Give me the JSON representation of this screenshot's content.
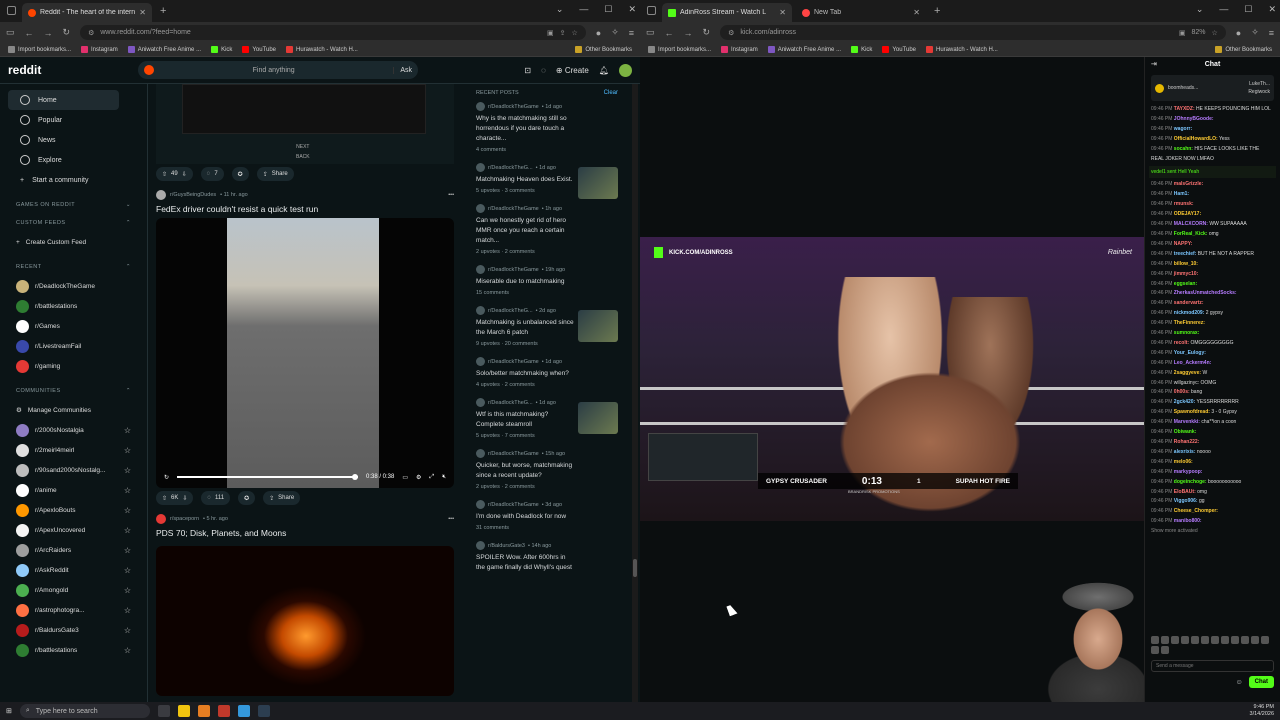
{
  "left_browser": {
    "tabs": [
      {
        "title": "Reddit - The heart of the intern",
        "active": true,
        "color": "#ff4500"
      }
    ],
    "url": "www.reddit.com/?feed=home",
    "bookmarks": [
      "Import bookmarks...",
      "Instagram",
      "Aniwatch Free Anime ...",
      "Kick",
      "YouTube",
      "Hurawatch - Watch H..."
    ],
    "other_bookmarks": "Other Bookmarks"
  },
  "right_browser": {
    "tabs": [
      {
        "title": "AdinRoss Stream - Watch L",
        "active": true,
        "color": "#53fc18"
      },
      {
        "title": "New Tab",
        "active": false,
        "color": "#ff4444"
      }
    ],
    "url": "kick.com/adinross",
    "zoom": "82%",
    "bookmarks": [
      "Import bookmarks...",
      "Instagram",
      "Aniwatch Free Anime ...",
      "Kick",
      "YouTube",
      "Hurawatch - Watch H..."
    ],
    "other_bookmarks": "Other Bookmarks"
  },
  "reddit": {
    "logo": "reddit",
    "search_placeholder": "Find anything",
    "ask_label": "Ask",
    "create_label": "Create",
    "nav": [
      "Home",
      "Popular",
      "News",
      "Explore",
      "Start a community"
    ],
    "sections": {
      "games": "GAMES ON REDDIT",
      "custom": "CUSTOM FEEDS",
      "recent": "RECENT",
      "communities": "COMMUNITIES"
    },
    "create_custom_feed": "Create Custom Feed",
    "recent": [
      {
        "name": "r/DeadlockTheGame",
        "color": "#c9b37a"
      },
      {
        "name": "r/battlestations",
        "color": "#2e7d32"
      },
      {
        "name": "r/Games",
        "color": "#ffffff"
      },
      {
        "name": "r/LivestreamFail",
        "color": "#3949ab"
      },
      {
        "name": "r/gaming",
        "color": "#e53935"
      }
    ],
    "manage_communities": "Manage Communities",
    "communities": [
      {
        "name": "r/2000sNostalgia",
        "color": "#8e7cc3"
      },
      {
        "name": "r/2meirl4meirl",
        "color": "#e0e0e0"
      },
      {
        "name": "r/90sand2000sNostalg...",
        "color": "#bdbdbd"
      },
      {
        "name": "r/anime",
        "color": "#ffffff"
      },
      {
        "name": "r/ApexloBouts",
        "color": "#ff9800"
      },
      {
        "name": "r/ApexUncovered",
        "color": "#f5f5f5"
      },
      {
        "name": "r/ArcRaiders",
        "color": "#9e9e9e"
      },
      {
        "name": "r/AskReddit",
        "color": "#90caf9"
      },
      {
        "name": "r/Amongold",
        "color": "#4caf50"
      },
      {
        "name": "r/astrophotogra...",
        "color": "#ff7043"
      },
      {
        "name": "r/BaldursGate3",
        "color": "#b71c1c"
      },
      {
        "name": "r/battlestations",
        "color": "#2e7d32"
      }
    ],
    "feed": {
      "post1_next": "NEXT",
      "post1_back": "BACK",
      "post1_votes": "49",
      "post1_comments": "7",
      "share": "Share",
      "post2": {
        "sub": "r/GuysBeingDudes",
        "age": "• 11 hr. ago",
        "title": "FedEx driver couldn't resist a quick test run",
        "time": "0:38 / 0:38",
        "progress": 1.0,
        "votes": "6K",
        "comments": "111"
      },
      "post3": {
        "sub": "r/spaceporn",
        "age": "• 5 hr. ago",
        "title": "PDS 70; Disk, Planets, and Moons"
      }
    },
    "recent_posts": {
      "header": "RECENT POSTS",
      "clear": "Clear",
      "items": [
        {
          "sub": "r/DeadlockTheGame",
          "age": "• 1d ago",
          "title": "Why is the matchmaking still so horrendous if you dare touch a characte...",
          "stats": "4 comments",
          "thumb": false
        },
        {
          "sub": "r/DeadlockTheG...",
          "age": "• 1d ago",
          "title": "Matchmaking Heaven does Exist.",
          "stats": "5 upvotes · 3 comments",
          "thumb": true
        },
        {
          "sub": "r/DeadlockTheGame",
          "age": "• 1h ago",
          "title": "Can we honestly get rid of hero MMR once you reach a certain match...",
          "stats": "2 upvotes · 2 comments",
          "thumb": false
        },
        {
          "sub": "r/DeadlockTheGame",
          "age": "• 19h ago",
          "title": "Miserable due to matchmaking",
          "stats": "15 comments",
          "thumb": false
        },
        {
          "sub": "r/DeadlockTheG...",
          "age": "• 2d ago",
          "title": "Matchmaking is unbalanced since the March 6 patch",
          "stats": "9 upvotes · 20 comments",
          "thumb": true
        },
        {
          "sub": "r/DeadlockTheGame",
          "age": "• 1d ago",
          "title": "Solo/better matchmaking when?",
          "stats": "4 upvotes · 2 comments",
          "thumb": false
        },
        {
          "sub": "r/DeadlockTheG...",
          "age": "• 1d ago",
          "title": "Wtf is this matchmaking? Complete steamroll",
          "stats": "5 upvotes · 7 comments",
          "thumb": true
        },
        {
          "sub": "r/DeadlockTheGame",
          "age": "• 15h ago",
          "title": "Quicker, but worse, matchmaking since a recent update?",
          "stats": "2 upvotes · 2 comments",
          "thumb": false
        },
        {
          "sub": "r/DeadlockTheGame",
          "age": "• 3d ago",
          "title": "I'm done with Deadlock for now",
          "stats": "31 comments",
          "thumb": false
        },
        {
          "sub": "r/BaldursGate3",
          "age": "• 14h ago",
          "title": "SPOILER Wow. After 600hrs in the game finally did Whyll's quest",
          "stats": "",
          "thumb": false
        }
      ]
    }
  },
  "kick": {
    "overlay_tag": "KICK.COM/ADINROSS",
    "sponsor": "Rainbet",
    "fighter_left": "GYPSY CRUSADER",
    "fighter_right": "SUPAH HOT FIRE",
    "clock": "0:13",
    "round_badge": "1",
    "promo": "BRANDRISK PROMOTIONS",
    "chat": {
      "title": "Chat",
      "pinned_user": "boomheads...",
      "pinned_right_1": "LukeTh...",
      "pinned_right_2": "Regiwock",
      "alert": "vedel1 sent Hell Yeah",
      "messages": [
        {
          "time": "09:46 PM",
          "user": "TAYXDZ:",
          "text": "HE KEEPS POUNCING HIM LOL",
          "color": "#ff7373"
        },
        {
          "time": "09:46 PM",
          "user": "JOhnnyBGoode:",
          "text": "",
          "color": "#b67cff"
        },
        {
          "time": "09:46 PM",
          "user": "wagorr:",
          "text": "",
          "color": "#7cc7ff"
        },
        {
          "time": "09:46 PM",
          "user": "OfficialHowardLO:",
          "text": "Yess",
          "color": "#ffcc33"
        },
        {
          "time": "09:46 PM",
          "user": "socahn:",
          "text": "HIS FACE LOOKS LIKE THE",
          "color": "#53fc18"
        },
        {
          "time": "",
          "user": "",
          "text": "REAL JOKER NOW LMFAO",
          "color": "#ddd"
        },
        {
          "time": "09:46 PM",
          "user": "malsGrizzle:",
          "text": "",
          "color": "#ff7373"
        },
        {
          "time": "09:46 PM",
          "user": "Ham1:",
          "text": "",
          "color": "#7cc7ff"
        },
        {
          "time": "09:46 PM",
          "user": "rmunsk:",
          "text": "",
          "color": "#ff7373"
        },
        {
          "time": "09:46 PM",
          "user": "ODEJAY17:",
          "text": "",
          "color": "#ffcc33"
        },
        {
          "time": "09:46 PM",
          "user": "MALCXCORN:",
          "text": "WW SUPAAAAA",
          "color": "#b67cff"
        },
        {
          "time": "09:46 PM",
          "user": "ForReal_Kick:",
          "text": "omg",
          "color": "#53fc18"
        },
        {
          "time": "09:46 PM",
          "user": "NAPPY:",
          "text": "",
          "color": "#ff7373"
        },
        {
          "time": "09:46 PM",
          "user": "treechief:",
          "text": "BUT HE NOT A RAPPER",
          "color": "#7cc7ff"
        },
        {
          "time": "09:46 PM",
          "user": "billow_10:",
          "text": "",
          "color": "#ffcc33"
        },
        {
          "time": "09:46 PM",
          "user": "jimmyc10:",
          "text": "",
          "color": "#ff7373"
        },
        {
          "time": "09:46 PM",
          "user": "eggselan:",
          "text": "",
          "color": "#53fc18"
        },
        {
          "time": "09:46 PM",
          "user": "ZherkasUnmatchedSocks:",
          "text": "",
          "color": "#b67cff"
        },
        {
          "time": "09:46 PM",
          "user": "sandervartz:",
          "text": "",
          "color": "#ff7373"
        },
        {
          "time": "09:46 PM",
          "user": "nickmod209:",
          "text": "2 gypsy",
          "color": "#7cc7ff"
        },
        {
          "time": "09:46 PM",
          "user": "TheFinnerez:",
          "text": "",
          "color": "#ffcc33"
        },
        {
          "time": "09:46 PM",
          "user": "sumnorax:",
          "text": "",
          "color": "#53fc18"
        },
        {
          "time": "09:46 PM",
          "user": "recolt:",
          "text": "OMGGGGGGGGG",
          "color": "#ff7373"
        },
        {
          "time": "09:46 PM",
          "user": "Your_Eulogy:",
          "text": "",
          "color": "#7cc7ff"
        },
        {
          "time": "09:46 PM",
          "user": "Leo_Ackerm4n:",
          "text": "",
          "color": "#b67cff"
        },
        {
          "time": "09:46 PM",
          "user": "2saggyeve:",
          "text": "W",
          "color": "#ffcc33"
        },
        {
          "time": "09:46 PM",
          "user": "",
          "text": "willgazinyc: OOMG",
          "color": "#53fc18"
        },
        {
          "time": "09:46 PM",
          "user": "0h00s:",
          "text": "bang",
          "color": "#ff7373"
        },
        {
          "time": "09:46 PM",
          "user": "2gck420:",
          "text": "YESSRRRRRRRR",
          "color": "#7cc7ff"
        },
        {
          "time": "09:46 PM",
          "user": "Spawnofdread:",
          "text": "3 - 0 Gypsy",
          "color": "#ffcc33"
        },
        {
          "time": "09:46 PM",
          "user": "Marvenkki:",
          "text": "cha**ion a coon",
          "color": "#b67cff"
        },
        {
          "time": "09:46 PM",
          "user": "Obiwank:",
          "text": "",
          "color": "#53fc18"
        },
        {
          "time": "09:46 PM",
          "user": "Rohan222:",
          "text": "",
          "color": "#ff7373"
        },
        {
          "time": "09:46 PM",
          "user": "alexrixis:",
          "text": "noooo",
          "color": "#7cc7ff"
        },
        {
          "time": "09:46 PM",
          "user": "melo06:",
          "text": "",
          "color": "#ffcc33"
        },
        {
          "time": "09:46 PM",
          "user": "markypoop:",
          "text": "",
          "color": "#b67cff"
        },
        {
          "time": "09:46 PM",
          "user": "dogeinchoge:",
          "text": "booooooooooo",
          "color": "#53fc18"
        },
        {
          "time": "09:46 PM",
          "user": "EloBAUt:",
          "text": "omg",
          "color": "#ff7373"
        },
        {
          "time": "09:46 PM",
          "user": "Viggo906:",
          "text": "gg",
          "color": "#7cc7ff"
        },
        {
          "time": "09:46 PM",
          "user": "Cheese_Chomper:",
          "text": "",
          "color": "#ffcc33"
        },
        {
          "time": "09:46 PM",
          "user": "manibo800:",
          "text": "",
          "color": "#b67cff"
        }
      ],
      "show_more": "Show more activated",
      "input_placeholder": "Send a message",
      "send": "Chat"
    }
  },
  "taskbar": {
    "search": "Type here to search",
    "time": "9:46 PM",
    "date": "3/14/2026"
  }
}
